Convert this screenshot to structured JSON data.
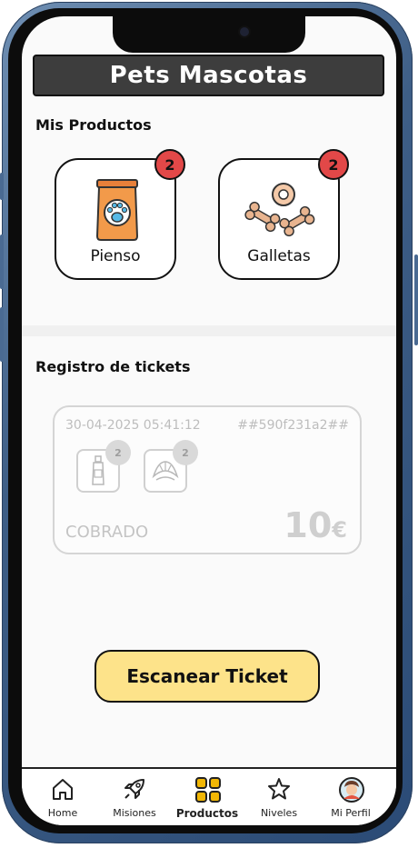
{
  "header": {
    "title": "Pets Mascotas"
  },
  "products_section": {
    "title": "Mis Productos",
    "items": [
      {
        "label": "Pienso",
        "count": "2",
        "icon": "pet-food-bag-icon"
      },
      {
        "label": "Galletas",
        "count": "2",
        "icon": "dog-biscuits-icon"
      }
    ]
  },
  "tickets_section": {
    "title": "Registro de tickets",
    "ticket": {
      "date": "30-04-2025 05:41:12",
      "id": "##590f231a2##",
      "items": [
        {
          "icon": "bottle-icon",
          "count": "2"
        },
        {
          "icon": "croissant-icon",
          "count": "2"
        }
      ],
      "status": "COBRADO",
      "amount": "10",
      "currency": "€"
    }
  },
  "scan_button": {
    "label": "Escanear Ticket"
  },
  "nav": {
    "items": [
      {
        "label": "Home",
        "icon": "home-icon"
      },
      {
        "label": "Misiones",
        "icon": "rocket-icon"
      },
      {
        "label": "Productos",
        "icon": "grid-icon",
        "active": true
      },
      {
        "label": "Niveles",
        "icon": "star-icon"
      },
      {
        "label": "Mi Perfil",
        "icon": "avatar-icon"
      }
    ]
  },
  "colors": {
    "accent_yellow": "#fde38a",
    "badge_red": "#e24848",
    "active_nav": "#f2b705",
    "frame_blue": "#3e5e86"
  }
}
